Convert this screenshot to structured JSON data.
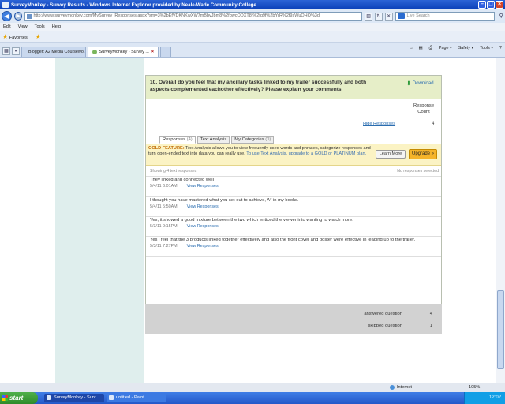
{
  "window": {
    "title": "SurveyMonkey - Survey Results - Windows Internet Explorer provided by Neale-Wade Community College"
  },
  "address": {
    "url": "http://www.surveymonkey.com/MySurvey_Responses.aspx?sm=3%2bEfVDKNKwXW7mBbvJbm8%2fbwcQDXT8t%2fg9f%2bYrR%2f9sWuQHQ%3d",
    "search_placeholder": "Live Search"
  },
  "menu": [
    "Edit",
    "View",
    "Tools",
    "Help"
  ],
  "favorites": {
    "label": "Favorites"
  },
  "tabs": [
    {
      "label": "Blogger: A2 Media Coursewo..."
    },
    {
      "label": "SurveyMonkey - Survey ..."
    }
  ],
  "tab_tools": [
    "Page ▾",
    "Safety ▾",
    "Tools ▾"
  ],
  "question": {
    "title": "10. Overall do you feel that my ancillary tasks linked to my trailer successfully and both aspects complemented eachother effectively? Please explain your comments.",
    "download_label": "Download",
    "response_count_header": "Response Count",
    "hide_responses": "Hide Responses",
    "response_count": "4",
    "tabs": [
      {
        "label": "Responses",
        "count": "(4)"
      },
      {
        "label": "Text Analysis",
        "count": ""
      },
      {
        "label": "My Categories",
        "count": "(0)"
      }
    ],
    "gold": {
      "lead": "GOLD FEATURE:",
      "text": " Text Analysis allows you to view frequently used words and phrases, categorize responses and turn open-ended text into data you can really use. ",
      "upgrade_text": "To use Text Analysis, upgrade to a GOLD or PLATINUM plan.",
      "learn_more": "Learn More",
      "upgrade": "Upgrade »"
    },
    "showing": "Showing 4 text responses",
    "no_selected": "No responses selected",
    "responses": [
      {
        "text": "They linked and connected well",
        "date": "5/4/11 6:01AM",
        "link": "View Responses"
      },
      {
        "text": "I thought you have mastered what you set out to achieve, A* in my books.",
        "date": "5/4/11 5:50AM",
        "link": "View Responses"
      },
      {
        "text": "Yes, it showed a good mixture between the two which enticed the viewer into wanting to watch more.",
        "date": "5/3/11 9:15PM",
        "link": "View Responses"
      },
      {
        "text": "Yes i feel that the 3 products linked together effectively and also the front cover and poster were effective in leading up to the trailer.",
        "date": "5/3/11 7:27PM",
        "link": "View Responses"
      }
    ],
    "answered_label": "answered question",
    "answered_value": "4",
    "skipped_label": "skipped question",
    "skipped_value": "1"
  },
  "status": {
    "zone": "Internet",
    "zoom": "105%"
  },
  "taskbar": {
    "start": "start",
    "tasks": [
      "SurveyMonkey - Surv...",
      "untitled - Paint"
    ],
    "clock": "12:02"
  },
  "colors": {
    "question_header": "#e6eec8",
    "gold_banner": "#fbf3c4",
    "upgrade_button": "#f5b42a",
    "teal_column": "#dfeeed"
  }
}
